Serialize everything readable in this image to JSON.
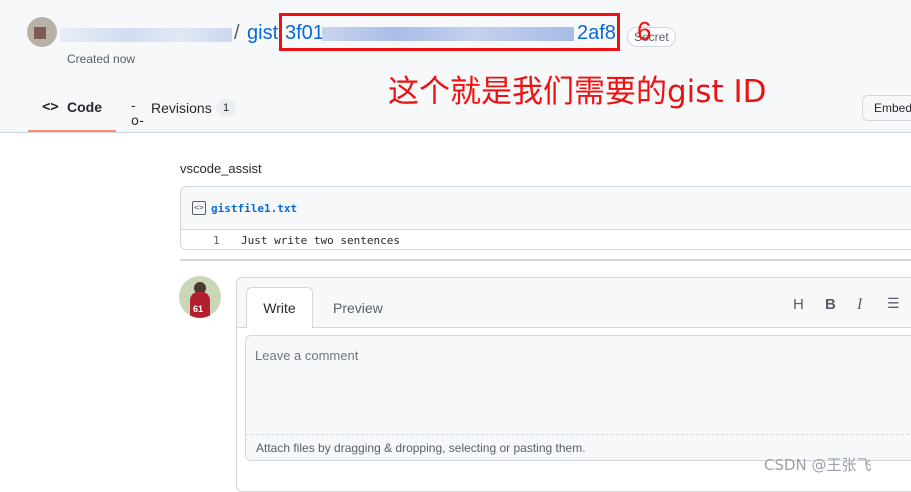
{
  "header": {
    "separator": "/",
    "gist_prefix": "gist",
    "gist_id_start": "3f01",
    "gist_id_end": "2af8",
    "secret_badge": "Secret",
    "created": "Created now"
  },
  "annotation": {
    "number": "6",
    "text": "这个就是我们需要的gist ID",
    "color": "#ee1111"
  },
  "tabs": {
    "code_label": "Code",
    "code_icon": "<>",
    "revisions_label": "Revisions",
    "revisions_count": "1"
  },
  "embed_label": "Embed",
  "description": "vscode_assist",
  "file": {
    "name": "gistfile1.txt",
    "line_number": "1",
    "line_text": "Just write two sentences"
  },
  "comment": {
    "tab_write": "Write",
    "tab_preview": "Preview",
    "toolbar": {
      "heading": "H",
      "bold": "B",
      "italic": "I",
      "quote": "☰"
    },
    "placeholder": "Leave a comment",
    "attach_hint": "Attach files by dragging & dropping, selecting or pasting them."
  },
  "watermark": "CSDN @王张飞"
}
